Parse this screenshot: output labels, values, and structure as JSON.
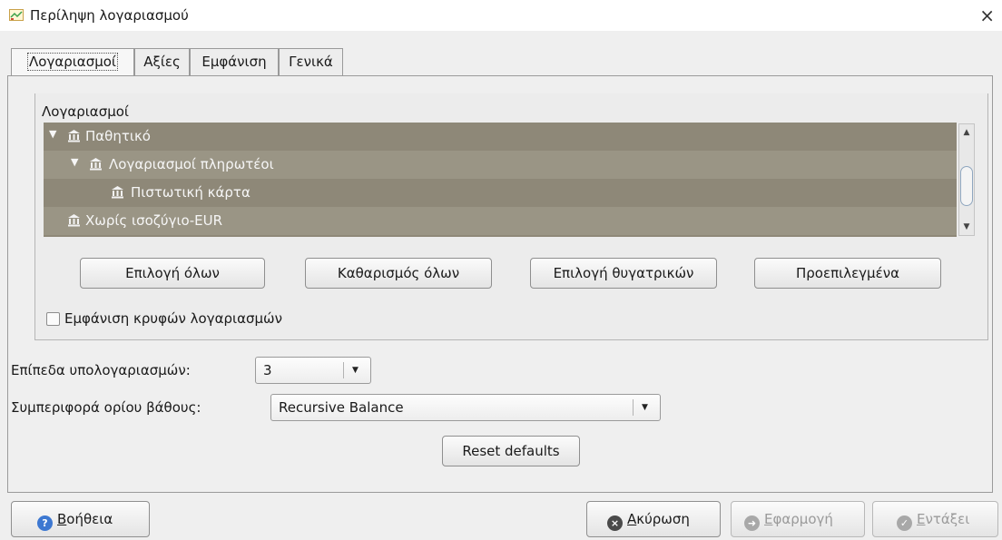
{
  "window": {
    "title": "Περίληψη λογαριασμού",
    "close_glyph": "×"
  },
  "tabs": [
    {
      "label": "Λογαριασμοί",
      "active": true
    },
    {
      "label": "Αξίες",
      "active": false
    },
    {
      "label": "Εμφάνιση",
      "active": false
    },
    {
      "label": "Γενικά",
      "active": false
    }
  ],
  "accounts_group": {
    "legend": "Λογαριασμοί",
    "tree": [
      {
        "label": "Παθητικό",
        "expanded": true,
        "icon": "bank-icon"
      },
      {
        "label": "Λογαριασμοί πληρωτέοι",
        "expanded": true,
        "icon": "bank-icon"
      },
      {
        "label": "Πιστωτική κάρτα",
        "icon": "bank-icon"
      },
      {
        "label": "Χωρίς ισοζύγιο-EUR",
        "icon": "bank-icon"
      }
    ],
    "buttons": {
      "select_all": "Επιλογή όλων",
      "clear_all": "Καθαρισμός όλων",
      "select_children": "Επιλογή θυγατρικών",
      "defaults": "Προεπιλεγμένα"
    },
    "show_hidden": {
      "label": "Εμφάνιση κρυφών λογαριασμών",
      "checked": false
    }
  },
  "sublevels": {
    "label": "Επίπεδα υπολογαριασμών:",
    "value": "3"
  },
  "depth_behavior": {
    "label": "Συμπεριφορά ορίου βάθους:",
    "value": "Recursive Balance"
  },
  "reset_defaults": "Reset defaults",
  "footer": {
    "help": {
      "mnemonic": "Β",
      "rest": "οήθεια",
      "icon": "help-icon"
    },
    "cancel": {
      "mnemonic": "Α",
      "rest": "κύρωση",
      "icon": "cancel-icon"
    },
    "apply": {
      "mnemonic": "Ε",
      "rest": "φαρμογή",
      "icon": "apply-icon",
      "enabled": false
    },
    "ok": {
      "mnemonic": "Ε",
      "rest": "ντάξει",
      "icon": "ok-icon",
      "enabled": false
    }
  },
  "colors": {
    "tree_bg": "#8e8878",
    "help_blue": "#3d78d1",
    "window_bg": "#efefef"
  }
}
